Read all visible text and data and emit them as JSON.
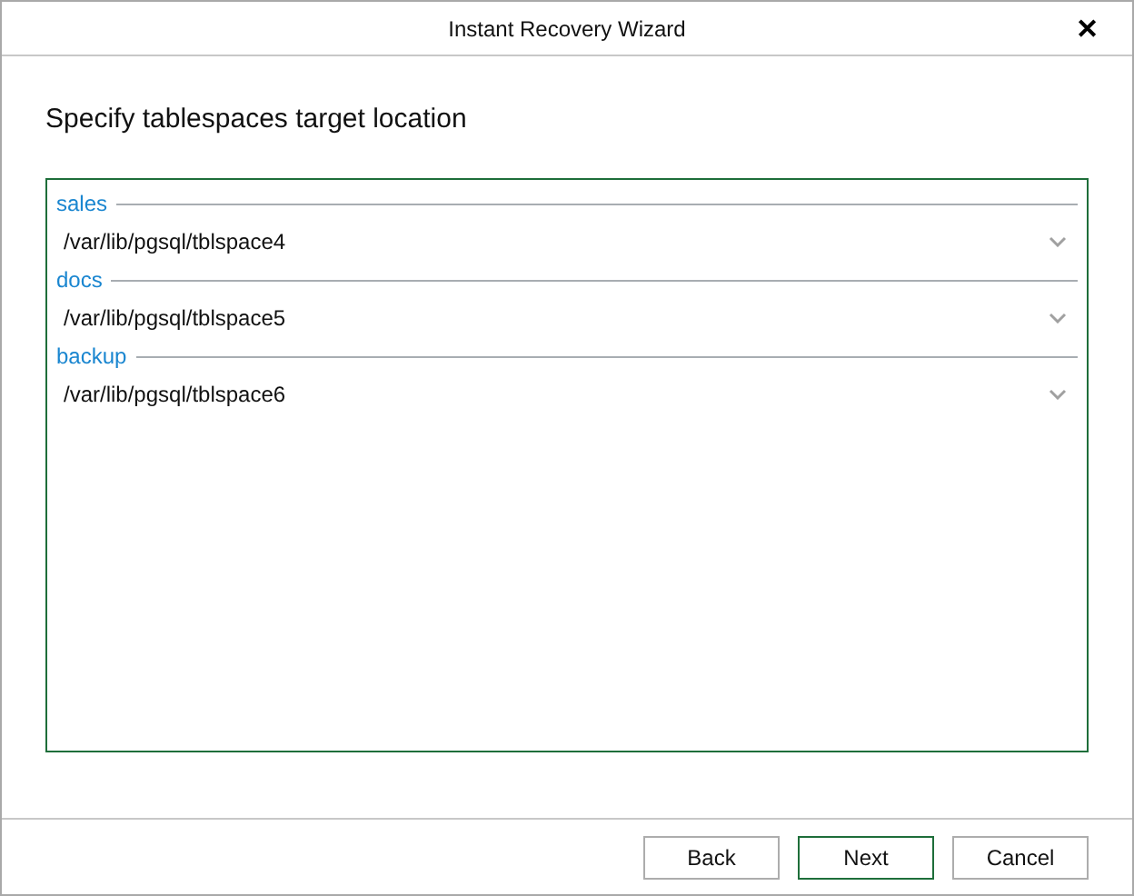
{
  "window": {
    "title": "Instant Recovery Wizard",
    "close": "✕"
  },
  "heading": "Specify tablespaces target location",
  "tablespaces": [
    {
      "name": "sales",
      "location": "/var/lib/pgsql/tblspace4"
    },
    {
      "name": "docs",
      "location": "/var/lib/pgsql/tblspace5"
    },
    {
      "name": "backup",
      "location": "/var/lib/pgsql/tblspace6"
    }
  ],
  "buttons": [
    {
      "label": "Back",
      "default": false
    },
    {
      "label": "Next",
      "default": true
    },
    {
      "label": "Cancel",
      "default": false
    }
  ]
}
